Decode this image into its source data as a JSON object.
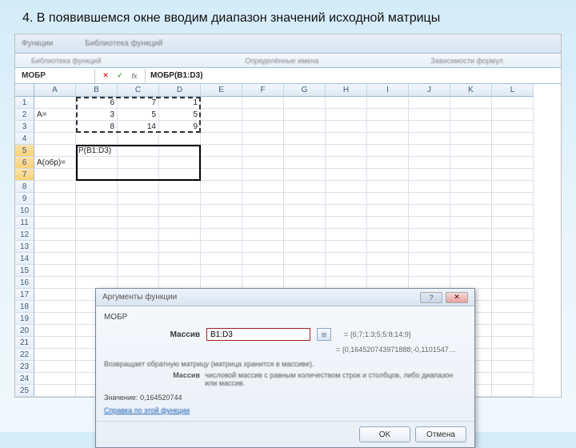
{
  "title": "4. В появившемся окне вводим диапазон значений исходной матрицы",
  "ribbon": {
    "top": [
      "Функции",
      "Библиотека функций",
      "",
      "Определённые имена",
      "",
      "Зависимости формул"
    ]
  },
  "name_box": "МОБР",
  "formula": "МОБР(B1:D3)",
  "cols": [
    "A",
    "B",
    "C",
    "D",
    "E",
    "F",
    "G",
    "H",
    "I",
    "J",
    "K",
    "L"
  ],
  "rows": 25,
  "cells": {
    "A1": "",
    "B1": "6",
    "C1": "7",
    "D1": "1",
    "A2": "A=",
    "B2": "3",
    "C2": "5",
    "D2": "5",
    "B3": "8",
    "C3": "14",
    "D3": "9",
    "B5": "Р(B1:D3)",
    "A6": "A(обр)="
  },
  "dialog": {
    "title": "Аргументы функции",
    "func": "МОБР",
    "arg_label": "Массив",
    "arg_value": "B1:D3",
    "arg_preview": "= {6;7;1:3;5;5:8;14;9}",
    "result_preview": "= {0,164520743971888;-0,1101547…",
    "desc": "Возвращает обратную матрицу (матрица хранится в массиве).",
    "arg_desc_label": "Массив",
    "arg_desc": "числовой массив с равным количеством строк и столбцов, либо диапазон или массив.",
    "value_label": "Значение:",
    "value": "0,164520744",
    "help": "Справка по этой функции",
    "ok": "OK",
    "cancel": "Отмена"
  }
}
